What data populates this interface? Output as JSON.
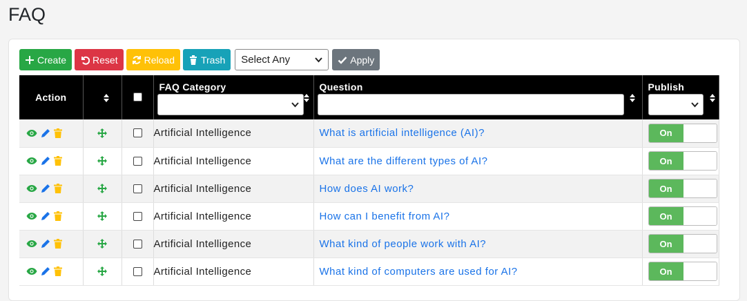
{
  "page": {
    "title": "FAQ"
  },
  "toolbar": {
    "create_label": "Create",
    "reset_label": "Reset",
    "reload_label": "Reload",
    "trash_label": "Trash",
    "select_value": "Select Any",
    "apply_label": "Apply"
  },
  "columns": {
    "action": "Action",
    "category": "FAQ Category",
    "question": "Question",
    "publish": "Publish"
  },
  "rows": [
    {
      "category": "Artificial Intelligence",
      "question": "What is artificial intelligence (AI)?",
      "publish": "On"
    },
    {
      "category": "Artificial Intelligence",
      "question": "What are the different types of AI?",
      "publish": "On"
    },
    {
      "category": "Artificial Intelligence",
      "question": "How does AI work?",
      "publish": "On"
    },
    {
      "category": "Artificial Intelligence",
      "question": "How can I benefit from AI?",
      "publish": "On"
    },
    {
      "category": "Artificial Intelligence",
      "question": "What kind of people work with AI?",
      "publish": "On"
    },
    {
      "category": "Artificial Intelligence",
      "question": "What kind of computers are used for AI?",
      "publish": "On"
    }
  ],
  "colors": {
    "create": "#28a745",
    "reset": "#dc3545",
    "reload": "#ffc107",
    "trash": "#17a2b8",
    "apply": "#6c757d",
    "view_icon": "#28a745",
    "edit_icon": "#1a73e8",
    "delete_icon": "#ffc107",
    "link": "#1a73e8",
    "toggle_on": "#5cb85c"
  },
  "icons": {
    "create": "plus-icon",
    "reset": "undo-icon",
    "reload": "refresh-icon",
    "trash": "trash-icon",
    "apply": "check-icon",
    "view": "eye-icon",
    "edit": "pencil-icon",
    "delete": "trash-icon",
    "move": "move-icon",
    "sort": "sort-icon"
  }
}
